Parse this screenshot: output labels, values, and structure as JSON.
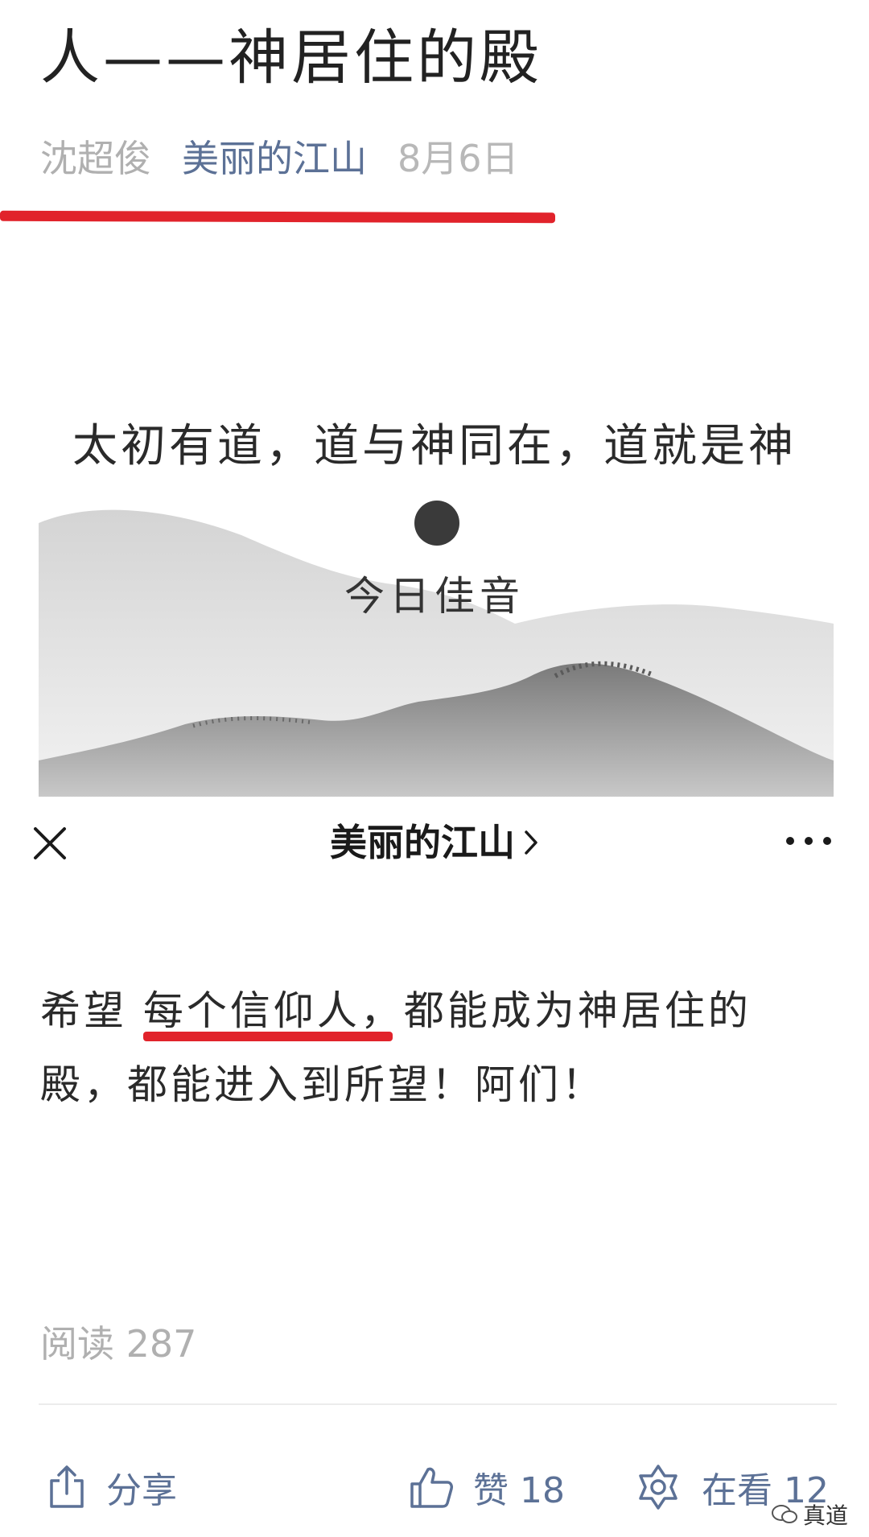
{
  "article": {
    "title": "人——神居住的殿",
    "author": "沈超俊",
    "account": "美丽的江山",
    "date": "8月6日"
  },
  "banner": {
    "quote": "太初有道，道与神同在，道就是神",
    "subtitle": "今日佳音"
  },
  "nav": {
    "title": "美丽的江山",
    "close_icon": "close-icon",
    "more_icon": "more-icon"
  },
  "body": {
    "prefix": "希望 ",
    "highlight": "每个信仰人",
    "suffix": "，都能成为神居住的殿，都能进入到所望！阿们！"
  },
  "stats": {
    "reads_label": "阅读 287"
  },
  "actions": {
    "share_label": "分享",
    "like_label": "赞 18",
    "watching_label": "在看 12"
  },
  "watermark": {
    "text": "真道"
  },
  "colors": {
    "link": "#5c7196",
    "annotation": "#e1232b",
    "muted": "#b0b0b0"
  }
}
